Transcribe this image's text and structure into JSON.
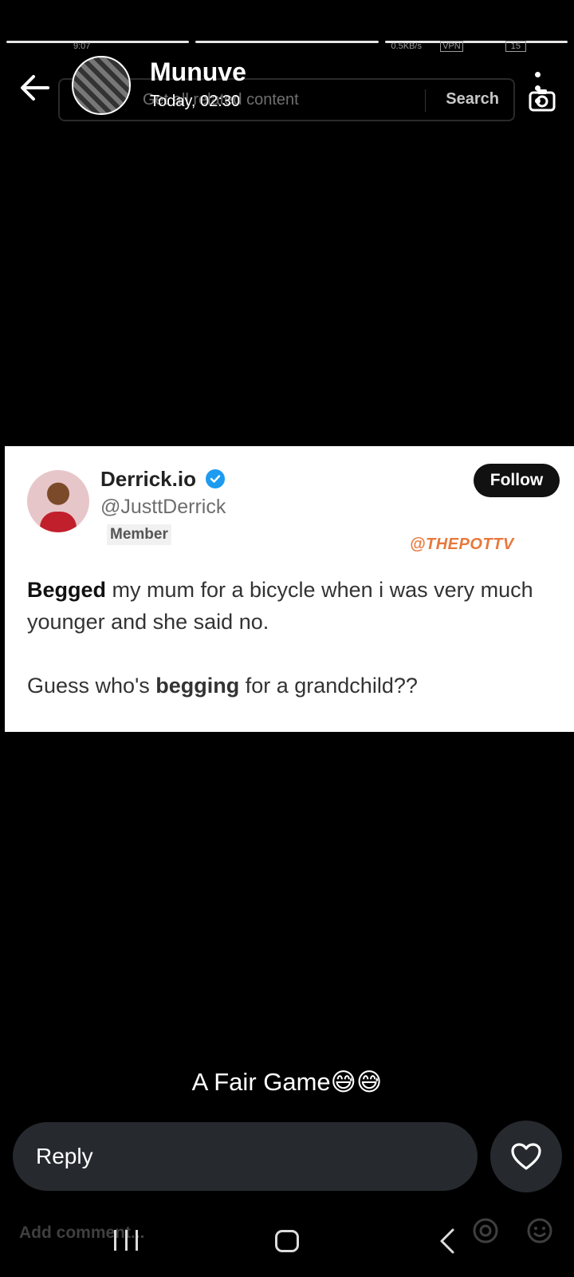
{
  "status_bar": {
    "time": "9:07",
    "net_speed": "0.5KB/s",
    "vpn": "VPN",
    "battery": "15"
  },
  "ghost_search": {
    "placeholder": "Get all related content",
    "button": "Search"
  },
  "header": {
    "username": "Munuve",
    "timestamp": "Today, 02:30"
  },
  "tweet": {
    "name": "Derrick.io",
    "handle": "@JusttDerrick",
    "badge": "Member",
    "follow_label": "Follow",
    "watermark": "@THEPOTTV",
    "line1_bold": "Begged",
    "line1_rest": " my mum for a bicycle when i was very much younger and she said no.",
    "line2_start": "Guess who's ",
    "line2_bold": "begging",
    "line2_end": " for a grandchild??"
  },
  "caption": "A Fair Game😅😅",
  "reply": {
    "placeholder": "Reply"
  },
  "ghost_bottom": {
    "comment_placeholder": "Add comment..."
  },
  "colors": {
    "background": "#000000",
    "reply_bg": "#262a2f",
    "verified": "#1d9bf0",
    "watermark": "#e8783c"
  },
  "icons": {
    "back": "arrow-left-icon",
    "more": "more-vertical-icon",
    "like": "heart-icon",
    "verified": "verified-badge-icon"
  },
  "story_progress": [
    1,
    1,
    1
  ]
}
